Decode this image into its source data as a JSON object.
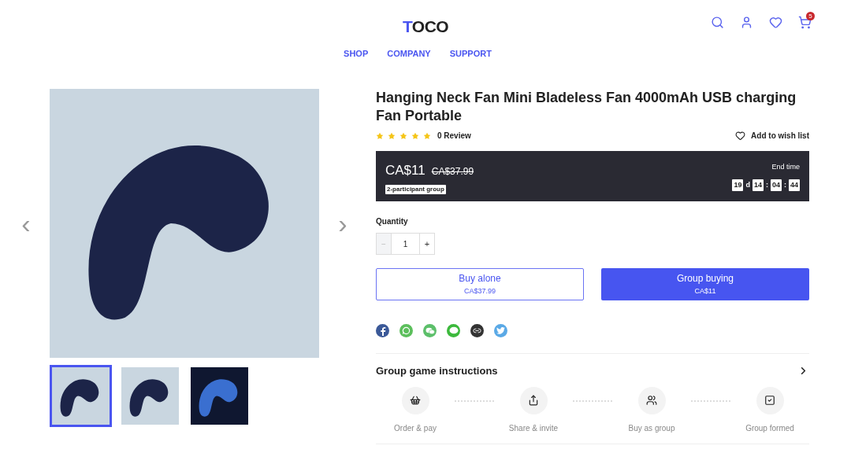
{
  "header": {
    "logo": "TOCO",
    "nav": [
      {
        "label": "SHOP"
      },
      {
        "label": "COMPANY"
      },
      {
        "label": "SUPPORT"
      }
    ],
    "cart_count": "5"
  },
  "gallery": {
    "prev": "‹",
    "next": "›",
    "thumbnails": [
      {
        "selected": true
      },
      {
        "selected": false
      },
      {
        "selected": false
      }
    ]
  },
  "product": {
    "title": "Hanging Neck Fan Mini Bladeless Fan 4000mAh USB charging Fan Portable",
    "stars": 5,
    "reviews": "0 Review",
    "wishlist": "Add to wish list",
    "deal": {
      "price": "CA$11",
      "old_price": "CA$37.99",
      "group_badge": "2-participant group",
      "end_label": "End time",
      "countdown": [
        {
          "kind": "box",
          "text": "19"
        },
        {
          "kind": "sep",
          "text": "d"
        },
        {
          "kind": "box",
          "text": "14"
        },
        {
          "kind": "sep",
          "text": ":"
        },
        {
          "kind": "box",
          "text": "04"
        },
        {
          "kind": "sep",
          "text": ":"
        },
        {
          "kind": "box",
          "text": "44"
        }
      ]
    },
    "quantity": {
      "label": "Quantity",
      "minus": "−",
      "value": "1",
      "plus": "+",
      "minus_disabled": true
    },
    "buttons": [
      {
        "kind": "outline",
        "label": "Buy alone",
        "price": "CA$37.99"
      },
      {
        "kind": "solid",
        "label": "Group buying",
        "price": "CA$11"
      }
    ],
    "share": [
      {
        "kind": "facebook",
        "color": "#3b5998"
      },
      {
        "kind": "whatsapp",
        "color": "#5cbf5c"
      },
      {
        "kind": "wechat",
        "color": "#5cbf6a"
      },
      {
        "kind": "line",
        "color": "#3cb93c"
      },
      {
        "kind": "link",
        "color": "#333333"
      },
      {
        "kind": "twitter",
        "color": "#5aa9e6"
      }
    ],
    "instructions": {
      "title": "Group game instructions",
      "steps": [
        {
          "kind": "order",
          "label": "Order & pay"
        },
        {
          "kind": "share",
          "label": "Share & invite"
        },
        {
          "kind": "group",
          "label": "Buy as group"
        },
        {
          "kind": "formed",
          "label": "Group formed"
        }
      ]
    }
  }
}
